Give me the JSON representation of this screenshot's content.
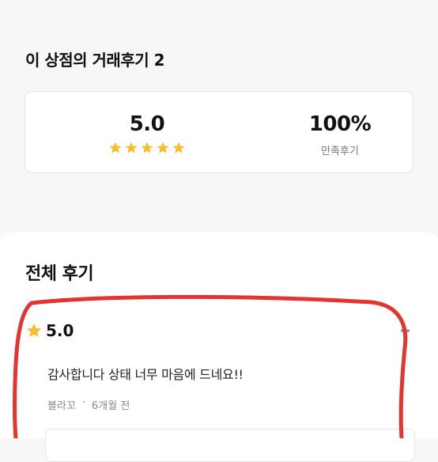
{
  "header": {
    "title": "이 상점의 거래후기 2"
  },
  "summary": {
    "rating": "5.0",
    "star_count": 5,
    "satisfaction": "100%",
    "satisfaction_label": "만족후기"
  },
  "reviews_section": {
    "title": "전체 후기"
  },
  "review": {
    "rating": "5.0",
    "text": "감사합니다 상태 너무 마음에 드네요!!",
    "author": "블라꼬",
    "separator": "·",
    "time": "6개월 전"
  },
  "colors": {
    "star": "#F5C02A",
    "annotation": "#E3342F"
  }
}
